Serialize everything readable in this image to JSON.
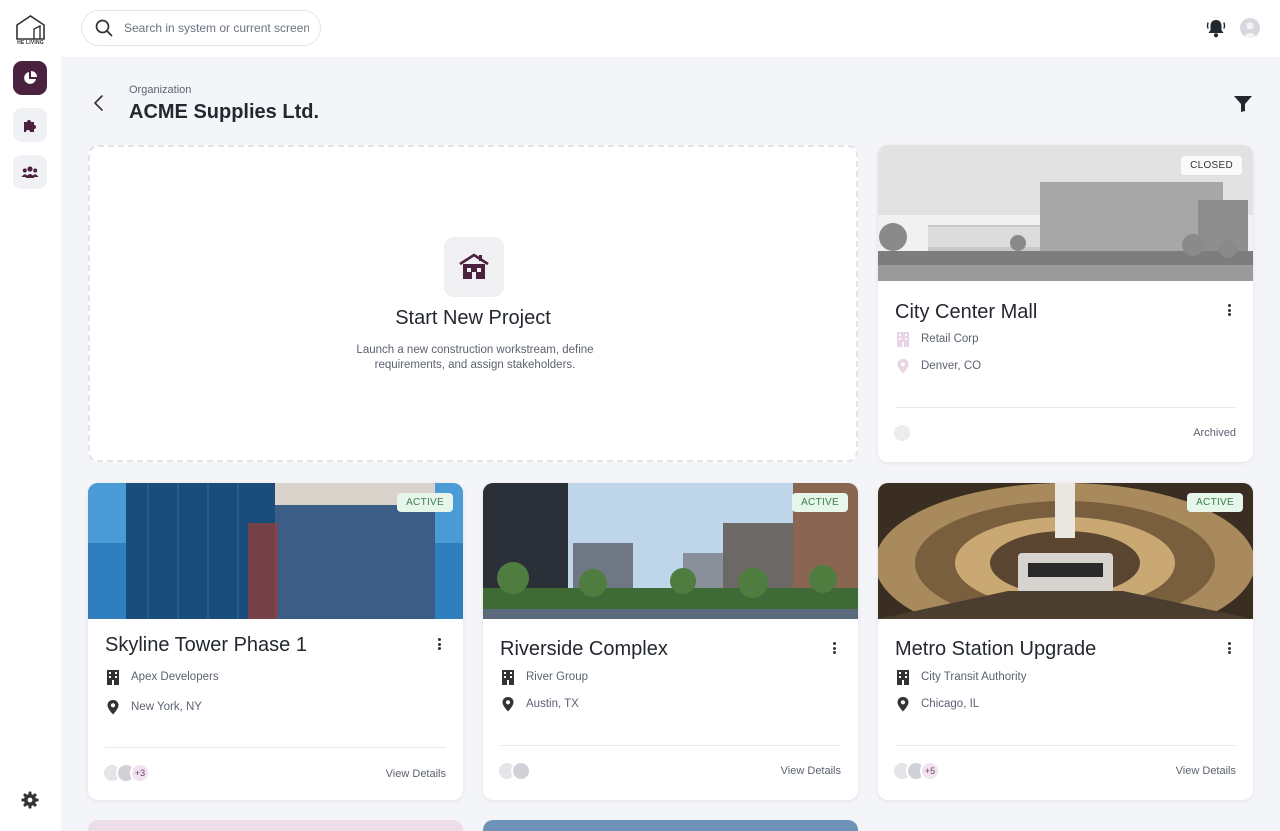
{
  "brand": {
    "logo_text": "HE LIVING"
  },
  "sidebar": {
    "items": [
      {
        "name": "dashboard",
        "icon": "pie-chart-icon",
        "active": true
      },
      {
        "name": "integrations",
        "icon": "puzzle-icon",
        "active": false
      },
      {
        "name": "teams",
        "icon": "people-icon",
        "active": false
      }
    ],
    "settings_icon": "gear-icon"
  },
  "topbar": {
    "search": {
      "placeholder": "Search in system or current screen",
      "value": ""
    },
    "bell_icon": "bell-icon",
    "avatar_icon": "user-avatar"
  },
  "header": {
    "breadcrumb": "Organization",
    "title": "ACME Supplies Ltd."
  },
  "new_project": {
    "title": "Start New Project",
    "description": "Launch a new construction workstream, define requirements, and assign stakeholders."
  },
  "colors": {
    "accent": "#4a2240",
    "active_badge_bg": "#e6f6ea",
    "active_badge_text": "#3c7d4c"
  },
  "projects": [
    {
      "title": "City Center Mall",
      "status": "CLOSED",
      "company": "Retail Corp",
      "location": "Denver, CO",
      "action": "Archived",
      "extra_members": ""
    },
    {
      "title": "Skyline Tower Phase 1",
      "status": "ACTIVE",
      "company": "Apex Developers",
      "location": "New York, NY",
      "action": "View Details",
      "extra_members": "+3"
    },
    {
      "title": "Riverside Complex",
      "status": "ACTIVE",
      "company": "River Group",
      "location": "Austin, TX",
      "action": "View Details",
      "extra_members": ""
    },
    {
      "title": "Metro Station Upgrade",
      "status": "ACTIVE",
      "company": "City Transit Authority",
      "location": "Chicago, IL",
      "action": "View Details",
      "extra_members": "+5"
    }
  ]
}
